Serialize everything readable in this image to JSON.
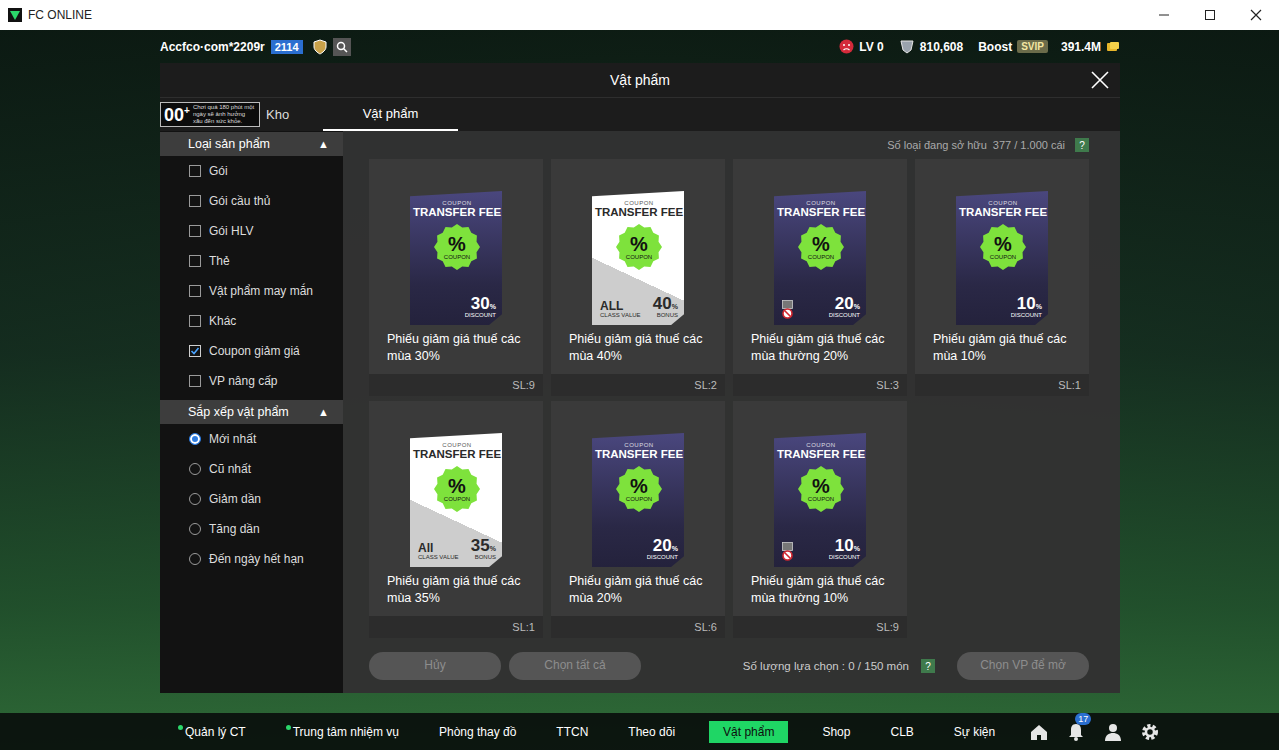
{
  "window": {
    "title": "FC ONLINE"
  },
  "topbar": {
    "account": "Accfco·com*2209r",
    "rank": "2114",
    "level": "LV 0",
    "points": "810,608",
    "boost": "Boost",
    "tier": "SVIP",
    "coins": "391.4M"
  },
  "modal": {
    "title": "Vật phẩm"
  },
  "age_notice": {
    "rating": "00",
    "plus": "+",
    "text": "Chơi quá 180 phút một ngày sẽ ảnh hưởng xấu đến sức khỏe."
  },
  "tabs": [
    {
      "label": "Kho",
      "selected": false
    },
    {
      "label": "Vật phẩm",
      "selected": true
    }
  ],
  "sidebar": {
    "sections": [
      {
        "title": "Loại sản phẩm",
        "toggle": "▲",
        "expanded": true,
        "kind": "checkbox",
        "items": [
          {
            "label": "Gói",
            "checked": false
          },
          {
            "label": "Gói cầu thủ",
            "checked": false
          },
          {
            "label": "Gói HLV",
            "checked": false
          },
          {
            "label": "Thẻ",
            "checked": false
          },
          {
            "label": "Vật phẩm may mắn",
            "checked": false
          },
          {
            "label": "Khác",
            "checked": false
          },
          {
            "label": "Coupon giảm giá",
            "checked": true
          },
          {
            "label": "VP nâng cấp",
            "checked": false
          }
        ]
      },
      {
        "title": "Sắp xếp vật phẩm",
        "toggle": "▲",
        "expanded": true,
        "kind": "radio",
        "items": [
          {
            "label": "Mới nhất",
            "checked": true
          },
          {
            "label": "Cũ nhất",
            "checked": false
          },
          {
            "label": "Giảm dần",
            "checked": false
          },
          {
            "label": "Tăng dần",
            "checked": false
          },
          {
            "label": "Đến ngày hết hạn",
            "checked": false
          }
        ]
      }
    ]
  },
  "inventory": {
    "label": "Số loại đang sở hữu",
    "count": "377 / 1.000 cái",
    "help": "?"
  },
  "coupon_art": {
    "top": "COUPON",
    "title": "TRANSFER FEE",
    "symbol": "%",
    "symbol_caption": "COUPON"
  },
  "items": [
    {
      "name": "Phiếu giảm giá thuế các mùa 30%",
      "quantity": "SL:9",
      "kind": "discount",
      "value": "30",
      "unit": "%",
      "tag": "DISCOUNT",
      "class_label": "",
      "class_caption": "",
      "restricted": false,
      "selected": false
    },
    {
      "name": "Phiếu giảm giá thuế các mùa 40%",
      "quantity": "SL:2",
      "kind": "bonus",
      "value": "40",
      "unit": "%",
      "tag": "BONUS",
      "class_label": "ALL",
      "class_caption": "CLASS VALUE",
      "restricted": false,
      "selected": false
    },
    {
      "name": "Phiếu giảm giá thuế các mùa thường 20%",
      "quantity": "SL:3",
      "kind": "discount",
      "value": "20",
      "unit": "%",
      "tag": "DISCOUNT",
      "class_label": "",
      "class_caption": "",
      "restricted": true,
      "selected": false
    },
    {
      "name": "Phiếu giảm giá thuế các mùa 10%",
      "quantity": "SL:1",
      "kind": "discount",
      "value": "10",
      "unit": "%",
      "tag": "DISCOUNT",
      "class_label": "",
      "class_caption": "",
      "restricted": false,
      "selected": false
    },
    {
      "name": "Phiếu giảm giá thuế các mùa 35%",
      "quantity": "SL:1",
      "kind": "bonus",
      "value": "35",
      "unit": "%",
      "tag": "BONUS",
      "class_label": "All",
      "class_caption": "CLASS VALUE",
      "restricted": false,
      "selected": false
    },
    {
      "name": "Phiếu giảm giá thuế các mùa 20%",
      "quantity": "SL:6",
      "kind": "discount",
      "value": "20",
      "unit": "%",
      "tag": "DISCOUNT",
      "class_label": "",
      "class_caption": "",
      "restricted": false,
      "selected": false
    },
    {
      "name": "Phiếu giảm giá thuế các mùa thường 10%",
      "quantity": "SL:9",
      "kind": "discount",
      "value": "10",
      "unit": "%",
      "tag": "DISCOUNT",
      "class_label": "",
      "class_caption": "",
      "restricted": true,
      "selected": false
    }
  ],
  "footer": {
    "buttons": [
      {
        "label": "Hủy",
        "disabled": true
      },
      {
        "label": "Chọn tất cả",
        "disabled": true
      }
    ],
    "selection": "Số lượng lựa chọn : 0 / 150 món",
    "help": "?",
    "open_button": {
      "label": "Chọn VP để mở",
      "disabled": true
    }
  },
  "bottom_nav": {
    "items": [
      {
        "label": "Quản lý CT",
        "selected": false,
        "dot": true
      },
      {
        "label": "Trung tâm nhiệm vụ",
        "selected": false,
        "dot": true
      },
      {
        "label": "Phòng thay đồ",
        "selected": false,
        "dot": false
      },
      {
        "label": "TTCN",
        "selected": false,
        "dot": false
      },
      {
        "label": "Theo dõi",
        "selected": false,
        "dot": false
      },
      {
        "label": "Vật phẩm",
        "selected": true,
        "dot": false
      },
      {
        "label": "Shop",
        "selected": false,
        "dot": false
      },
      {
        "label": "CLB",
        "selected": false,
        "dot": false
      },
      {
        "label": "Sự kiện",
        "selected": false,
        "dot": false
      }
    ],
    "notifications": "17"
  }
}
